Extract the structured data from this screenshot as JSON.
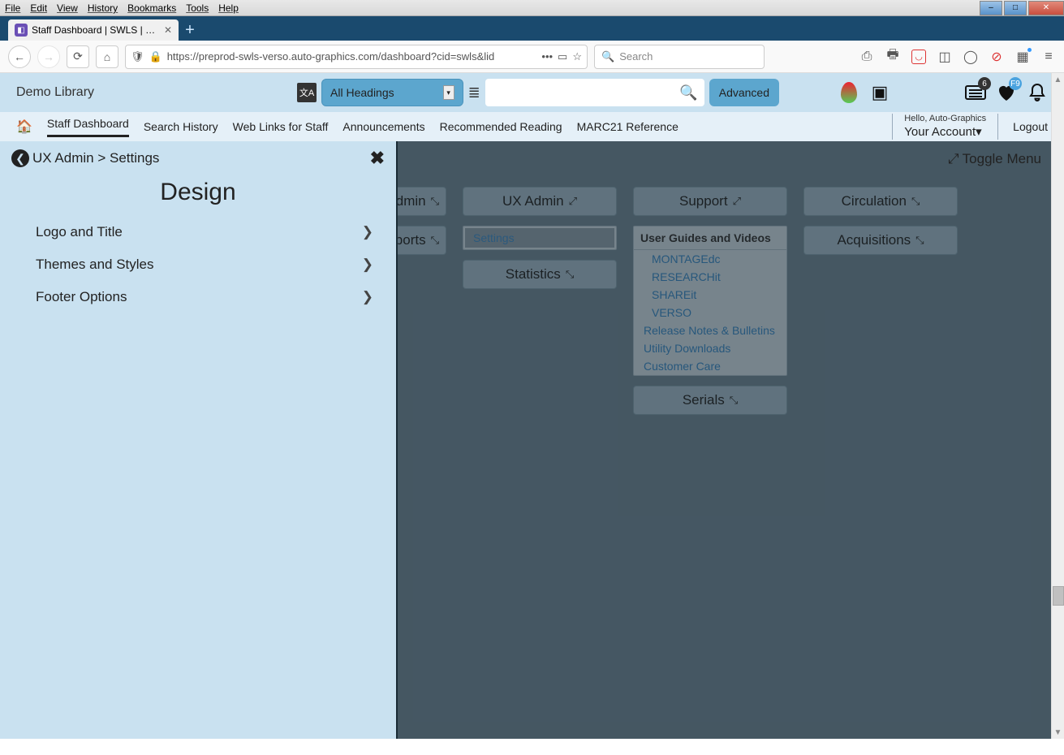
{
  "window": {
    "min": "–",
    "max": "□",
    "close": "✕"
  },
  "menubar": [
    "File",
    "Edit",
    "View",
    "History",
    "Bookmarks",
    "Tools",
    "Help"
  ],
  "tab": {
    "title": "Staff Dashboard | SWLS | SWLS"
  },
  "urlbar": {
    "url": "https://preprod-swls-verso.auto-graphics.com/dashboard?cid=swls&lid"
  },
  "browser_search": {
    "placeholder": "Search"
  },
  "app": {
    "library_name": "Demo Library",
    "headings_label": "All Headings",
    "advanced": "Advanced",
    "badges": {
      "list": "6",
      "heart": "F9"
    }
  },
  "nav": {
    "items": [
      "Staff Dashboard",
      "Search History",
      "Web Links for Staff",
      "Announcements",
      "Recommended Reading",
      "MARC21 Reference"
    ],
    "hello": "Hello, Auto-Graphics",
    "account": "Your Account",
    "logout": "Logout"
  },
  "dashboard": {
    "toggle": "Toggle Menu",
    "col1": {
      "admin": "c Admin",
      "reports": "c Reports"
    },
    "col2": {
      "ux": "UX Admin",
      "settings": "Settings",
      "stats": "Statistics"
    },
    "col3": {
      "support": "Support",
      "section": "User Guides and Videos",
      "links": [
        "MONTAGEdc",
        "RESEARCHit",
        "SHAREit",
        "VERSO",
        "Release Notes & Bulletins",
        "Utility Downloads",
        "Customer Care"
      ],
      "serials": "Serials"
    },
    "col4": {
      "circ": "Circulation",
      "acq": "Acquisitions"
    }
  },
  "panel": {
    "breadcrumb1": "UX Admin",
    "sep": ">",
    "breadcrumb2": "Settings",
    "title": "Design",
    "items": [
      "Logo and Title",
      "Themes and Styles",
      "Footer Options"
    ]
  }
}
